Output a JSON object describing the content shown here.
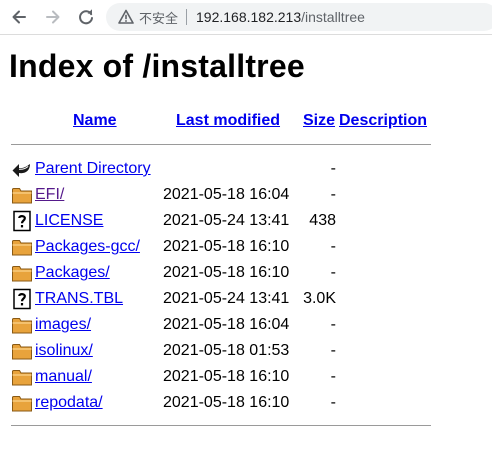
{
  "browser": {
    "security_label": "不安全",
    "url_host": "192.168.182.213",
    "url_path": "/installtree",
    "icons": [
      "back-icon",
      "forward-icon",
      "reload-icon",
      "warning-icon"
    ]
  },
  "page": {
    "title": "Index of /installtree",
    "columns": {
      "name": "Name",
      "last_modified": "Last modified",
      "size": "Size",
      "description": "Description"
    },
    "entries": [
      {
        "icon": "back-arrow-icon",
        "name": "Parent Directory",
        "date": "",
        "size": "-",
        "visited": false
      },
      {
        "icon": "folder-icon",
        "name": "EFI/",
        "date": "2021-05-18 16:04",
        "size": "-",
        "visited": true
      },
      {
        "icon": "unknown-file-icon",
        "name": "LICENSE",
        "date": "2021-05-24 13:41",
        "size": "438",
        "visited": false
      },
      {
        "icon": "folder-icon",
        "name": "Packages-gcc/",
        "date": "2021-05-18 16:10",
        "size": "-",
        "visited": false
      },
      {
        "icon": "folder-icon",
        "name": "Packages/",
        "date": "2021-05-18 16:10",
        "size": "-",
        "visited": false
      },
      {
        "icon": "unknown-file-icon",
        "name": "TRANS.TBL",
        "date": "2021-05-24 13:41",
        "size": "3.0K",
        "visited": false
      },
      {
        "icon": "folder-icon",
        "name": "images/",
        "date": "2021-05-18 16:04",
        "size": "-",
        "visited": false
      },
      {
        "icon": "folder-icon",
        "name": "isolinux/",
        "date": "2021-05-18 01:53",
        "size": "-",
        "visited": false
      },
      {
        "icon": "folder-icon",
        "name": "manual/",
        "date": "2021-05-18 16:10",
        "size": "-",
        "visited": false
      },
      {
        "icon": "folder-icon",
        "name": "repodata/",
        "date": "2021-05-18 16:10",
        "size": "-",
        "visited": false
      }
    ],
    "colors": {
      "link": "#0000ee",
      "visited_link": "#551a8b",
      "folder": "#e8a33c"
    }
  }
}
